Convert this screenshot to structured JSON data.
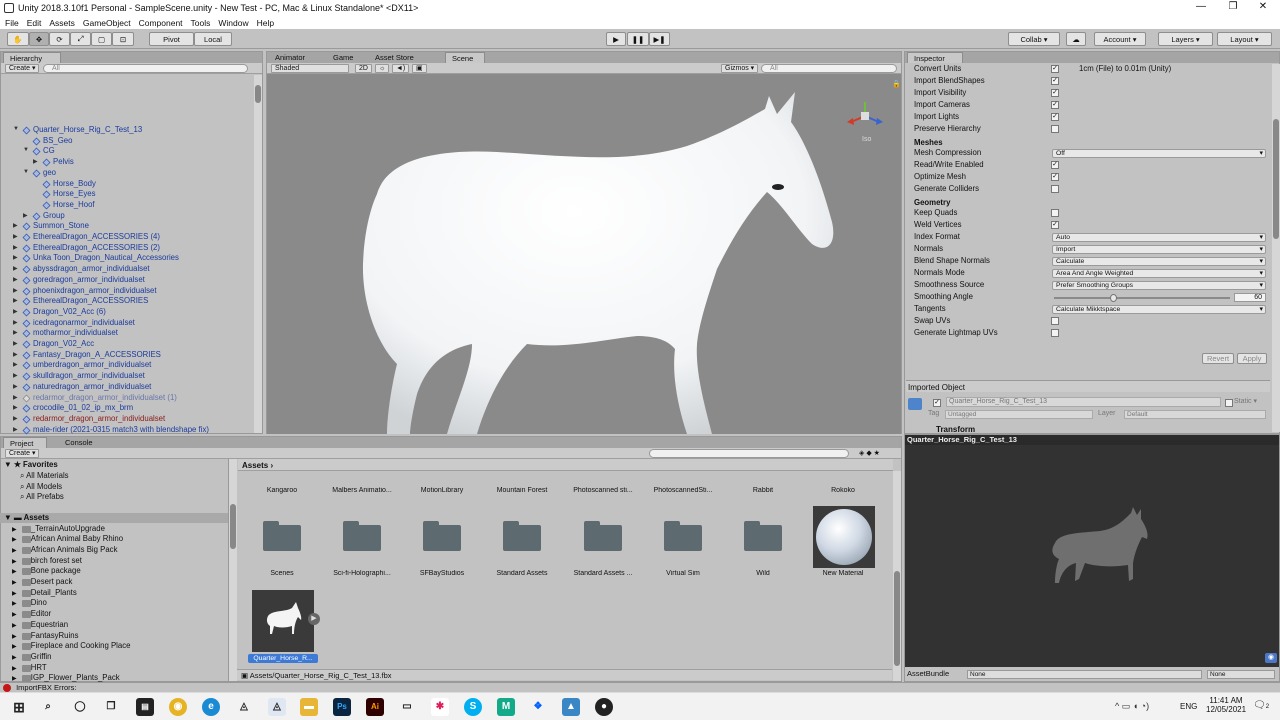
{
  "window": {
    "title": "Unity 2018.3.10f1 Personal - SampleScene.unity - New Test - PC, Mac & Linux Standalone* <DX11>"
  },
  "menu": [
    "File",
    "Edit",
    "Assets",
    "GameObject",
    "Component",
    "Tools",
    "Window",
    "Help"
  ],
  "toolbar": {
    "pivot": "Pivot",
    "local": "Local",
    "collab": "Collab ▾",
    "account": "Account",
    "layers": "Layers",
    "layout": "Layout"
  },
  "hierarchy": {
    "tab": "Hierarchy",
    "create": "Create ▾",
    "search": "All",
    "items": [
      {
        "label": "Quarter_Horse_Rig_C_Test_13",
        "indent": 0,
        "arrow": "▼",
        "style": "blue"
      },
      {
        "label": "BS_Geo",
        "indent": 1,
        "arrow": "",
        "style": "blue"
      },
      {
        "label": "CG",
        "indent": 1,
        "arrow": "▼",
        "style": "blue"
      },
      {
        "label": "Pelvis",
        "indent": 2,
        "arrow": "▶",
        "style": "blue"
      },
      {
        "label": "geo",
        "indent": 1,
        "arrow": "▼",
        "style": "blue"
      },
      {
        "label": "Horse_Body",
        "indent": 2,
        "arrow": "",
        "style": "blue"
      },
      {
        "label": "Horse_Eyes",
        "indent": 2,
        "arrow": "",
        "style": "blue"
      },
      {
        "label": "Horse_Hoof",
        "indent": 2,
        "arrow": "",
        "style": "blue"
      },
      {
        "label": "Group",
        "indent": 1,
        "arrow": "▶",
        "style": "blue"
      },
      {
        "label": "Summon_Stone",
        "indent": 0,
        "arrow": "▶",
        "style": "blue"
      },
      {
        "label": "EtherealDragon_ACCESSORIES (4)",
        "indent": 0,
        "arrow": "▶",
        "style": "blue"
      },
      {
        "label": "EtherealDragon_ACCESSORIES (2)",
        "indent": 0,
        "arrow": "▶",
        "style": "blue"
      },
      {
        "label": "Unka Toon_Dragon_Nautical_Accessories",
        "indent": 0,
        "arrow": "▶",
        "style": "blue"
      },
      {
        "label": "abyssdragon_armor_individualset",
        "indent": 0,
        "arrow": "▶",
        "style": "blue"
      },
      {
        "label": "goredragon_armor_individualset",
        "indent": 0,
        "arrow": "▶",
        "style": "blue"
      },
      {
        "label": "phoenixdragon_armor_individualset",
        "indent": 0,
        "arrow": "▶",
        "style": "blue"
      },
      {
        "label": "EtherealDragon_ACCESSORIES",
        "indent": 0,
        "arrow": "▶",
        "style": "blue"
      },
      {
        "label": "Dragon_V02_Acc (6)",
        "indent": 0,
        "arrow": "▶",
        "style": "blue"
      },
      {
        "label": "icedragonarmor_individualset",
        "indent": 0,
        "arrow": "▶",
        "style": "blue"
      },
      {
        "label": "motharmor_individualset",
        "indent": 0,
        "arrow": "▶",
        "style": "blue"
      },
      {
        "label": "Dragon_V02_Acc",
        "indent": 0,
        "arrow": "▶",
        "style": "blue"
      },
      {
        "label": "Fantasy_Dragon_A_ACCESSORIES",
        "indent": 0,
        "arrow": "▶",
        "style": "blue"
      },
      {
        "label": "umberdragon_armor_individualset",
        "indent": 0,
        "arrow": "▶",
        "style": "blue"
      },
      {
        "label": "skulldragon_armor_individualset",
        "indent": 0,
        "arrow": "▶",
        "style": "blue"
      },
      {
        "label": "naturedragon_armor_individualset",
        "indent": 0,
        "arrow": "▶",
        "style": "blue"
      },
      {
        "label": "redarmor_dragon_armor_individualset (1)",
        "indent": 0,
        "arrow": "▶",
        "style": "dim"
      },
      {
        "label": "crocodile_01_02_ip_mx_brm",
        "indent": 0,
        "arrow": "▶",
        "style": "blue"
      },
      {
        "label": "redarmor_dragon_armor_individualset",
        "indent": 0,
        "arrow": "▶",
        "style": "red"
      },
      {
        "label": "male-rider (2021-0315 match3 with blendshape fix)",
        "indent": 0,
        "arrow": "▶",
        "style": "blue"
      },
      {
        "label": "dromader_fv_ip_mx_brm (1)",
        "indent": 0,
        "arrow": "▶",
        "style": "blue"
      },
      {
        "label": "dromader_fv_ip_mx_brm",
        "indent": 0,
        "arrow": "▶",
        "style": "blue"
      },
      {
        "label": "Horse Realistic (3)",
        "indent": 0,
        "arrow": "▶",
        "style": "blue"
      },
      {
        "label": "Horse Realistic (2)",
        "indent": 0,
        "arrow": "▶",
        "style": "blue"
      },
      {
        "label": "kang (1)",
        "indent": 0,
        "arrow": "▶",
        "style": "blue"
      }
    ]
  },
  "sceneTabs": [
    "Animator",
    "Game",
    "Asset Store",
    "Scene"
  ],
  "sceneBar": {
    "shading": "Shaded",
    "mode2d": "2D",
    "gizmos": "Gizmos ▾",
    "search": "All",
    "persp": "Iso"
  },
  "inspector": {
    "tab": "Inspector",
    "rows": [
      {
        "label": "Convert Units",
        "kind": "check",
        "checked": true,
        "extra": "1cm (File) to 0.01m (Unity)"
      },
      {
        "label": "Import BlendShapes",
        "kind": "check",
        "checked": true
      },
      {
        "label": "Import Visibility",
        "kind": "check",
        "checked": true
      },
      {
        "label": "Import Cameras",
        "kind": "check",
        "checked": true
      },
      {
        "label": "Import Lights",
        "kind": "check",
        "checked": true
      },
      {
        "label": "Preserve Hierarchy",
        "kind": "check",
        "checked": false
      },
      {
        "label": "Meshes",
        "kind": "header"
      },
      {
        "label": "Mesh Compression",
        "kind": "drop",
        "value": "Off"
      },
      {
        "label": "Read/Write Enabled",
        "kind": "check",
        "checked": true
      },
      {
        "label": "Optimize Mesh",
        "kind": "check",
        "checked": true
      },
      {
        "label": "Generate Colliders",
        "kind": "check",
        "checked": false
      },
      {
        "label": "Geometry",
        "kind": "header"
      },
      {
        "label": "Keep Quads",
        "kind": "check",
        "checked": false
      },
      {
        "label": "Weld Vertices",
        "kind": "check",
        "checked": true
      },
      {
        "label": "Index Format",
        "kind": "drop",
        "value": "Auto"
      },
      {
        "label": "Normals",
        "kind": "drop",
        "value": "Import"
      },
      {
        "label": "Blend Shape Normals",
        "kind": "drop",
        "value": "Calculate"
      },
      {
        "label": "Normals Mode",
        "kind": "drop",
        "value": "Area And Angle Weighted"
      },
      {
        "label": "Smoothness Source",
        "kind": "drop",
        "value": "Prefer Smoothing Groups"
      },
      {
        "label": "Smoothing Angle",
        "kind": "slider",
        "value": "60"
      },
      {
        "label": "Tangents",
        "kind": "drop",
        "value": "Calculate Mikktspace"
      },
      {
        "label": "Swap UVs",
        "kind": "check",
        "checked": false
      },
      {
        "label": "Generate Lightmap UVs",
        "kind": "check",
        "checked": false
      }
    ],
    "revert": "Revert",
    "apply": "Apply",
    "importedObject": "Imported Object",
    "objectName": "Quarter_Horse_Rig_C_Test_13",
    "static": "Static ▾",
    "tagLabel": "Tag",
    "tagValue": "Untagged",
    "layerLabel": "Layer",
    "layerValue": "Default",
    "transform": "Transform",
    "previewTitle": "Quarter_Horse_Rig_C_Test_13",
    "assetBundle": "AssetBundle",
    "bundleNone": "None",
    "bundleNone2": "None"
  },
  "project": {
    "tabs": [
      "Project",
      "Console"
    ],
    "create": "Create ▾",
    "favorites": {
      "title": "Favorites",
      "items": [
        "All Materials",
        "All Models",
        "All Prefabs"
      ]
    },
    "assetsTitle": "Assets",
    "tree": [
      "_TerrainAutoUpgrade",
      "African Animal Baby Rhino",
      "African Animals Big Pack",
      "birch forest set",
      "Bone package",
      "Desert pack",
      "Detail_Plants",
      "Dino",
      "Editor",
      "Equestrian",
      "FantasyRuins",
      "Fireplace and Cooking Place",
      "Griffin",
      "HRT",
      "IGP_Flower_Plants_Pack"
    ],
    "breadcrumb": "Assets ›",
    "topRow": [
      "Kangaroo",
      "Malbers Animatio...",
      "MotionLibrary",
      "Mountain Forest",
      "Photoscanned sti...",
      "PhotoscannedSti...",
      "Rabbit",
      "Rokoko"
    ],
    "folders": [
      "Scenes",
      "Sci-fi-Holographi...",
      "SFBayStudios",
      "Standard Assets",
      "Standard Assets ...",
      "Virtual Sim",
      "Wild"
    ],
    "material": "New Material",
    "selectedAsset": "Quarter_Horse_R...",
    "path": "Assets/Quarter_Horse_Rig_C_Test_13.fbx"
  },
  "status": {
    "error": "ImportFBX Errors:"
  },
  "taskbar": {
    "time": "11:41 AM",
    "date": "12/05/2021",
    "lang": "ENG",
    "notif": "2"
  },
  "colors": {
    "accent": "#3d7ad6",
    "error": "#c41616",
    "chrome": "#c2c2c2",
    "scene": "#8a8a8a"
  }
}
